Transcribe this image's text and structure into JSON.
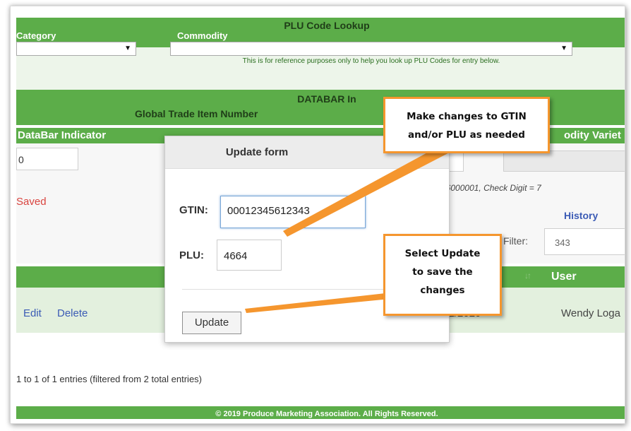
{
  "lookup": {
    "title": "PLU Code Lookup",
    "category_label": "Category",
    "commodity_label": "Commodity",
    "category_select": "▼",
    "commodity_select": "▼",
    "note": "This is for reference purposes only to help you look up PLU Codes for entry below."
  },
  "databar": {
    "title": "DATABAR In",
    "gtin_title": "Global Trade Item Number",
    "indicator_header": "DataBar Indicator",
    "variety_header": "odity Variet",
    "indicator_value": "0",
    "saved_text": "Saved",
    "check_digit_text": "23456000001, Check Digit = 7",
    "history_link": "History",
    "filter_label": "Filter:",
    "filter_value": "343"
  },
  "table": {
    "user_header": "User",
    "sort_arrows": "↓↑",
    "edit_link": "Edit",
    "delete_link": "Delete",
    "row_date": "1/2/2020",
    "row_user": "Wendy Loga",
    "entries_text": "1 to 1 of 1 entries (filtered from 2 total entries)"
  },
  "footer": {
    "text": "© 2019 Produce Marketing Association. All Rights Reserved."
  },
  "modal": {
    "title": "Update form",
    "gtin_label": "GTIN:",
    "gtin_value": "00012345612343",
    "plu_label": "PLU:",
    "plu_value": "4664",
    "update_button": "Update"
  },
  "callouts": {
    "first": [
      "Make changes to GTIN",
      "and/or PLU as needed"
    ],
    "second": [
      "Select Update",
      "to save the",
      "changes"
    ]
  },
  "colors": {
    "green": "#5cad49",
    "orange": "#f5962e",
    "link_blue": "#3b5bb5",
    "saved_red": "#d9443f"
  }
}
